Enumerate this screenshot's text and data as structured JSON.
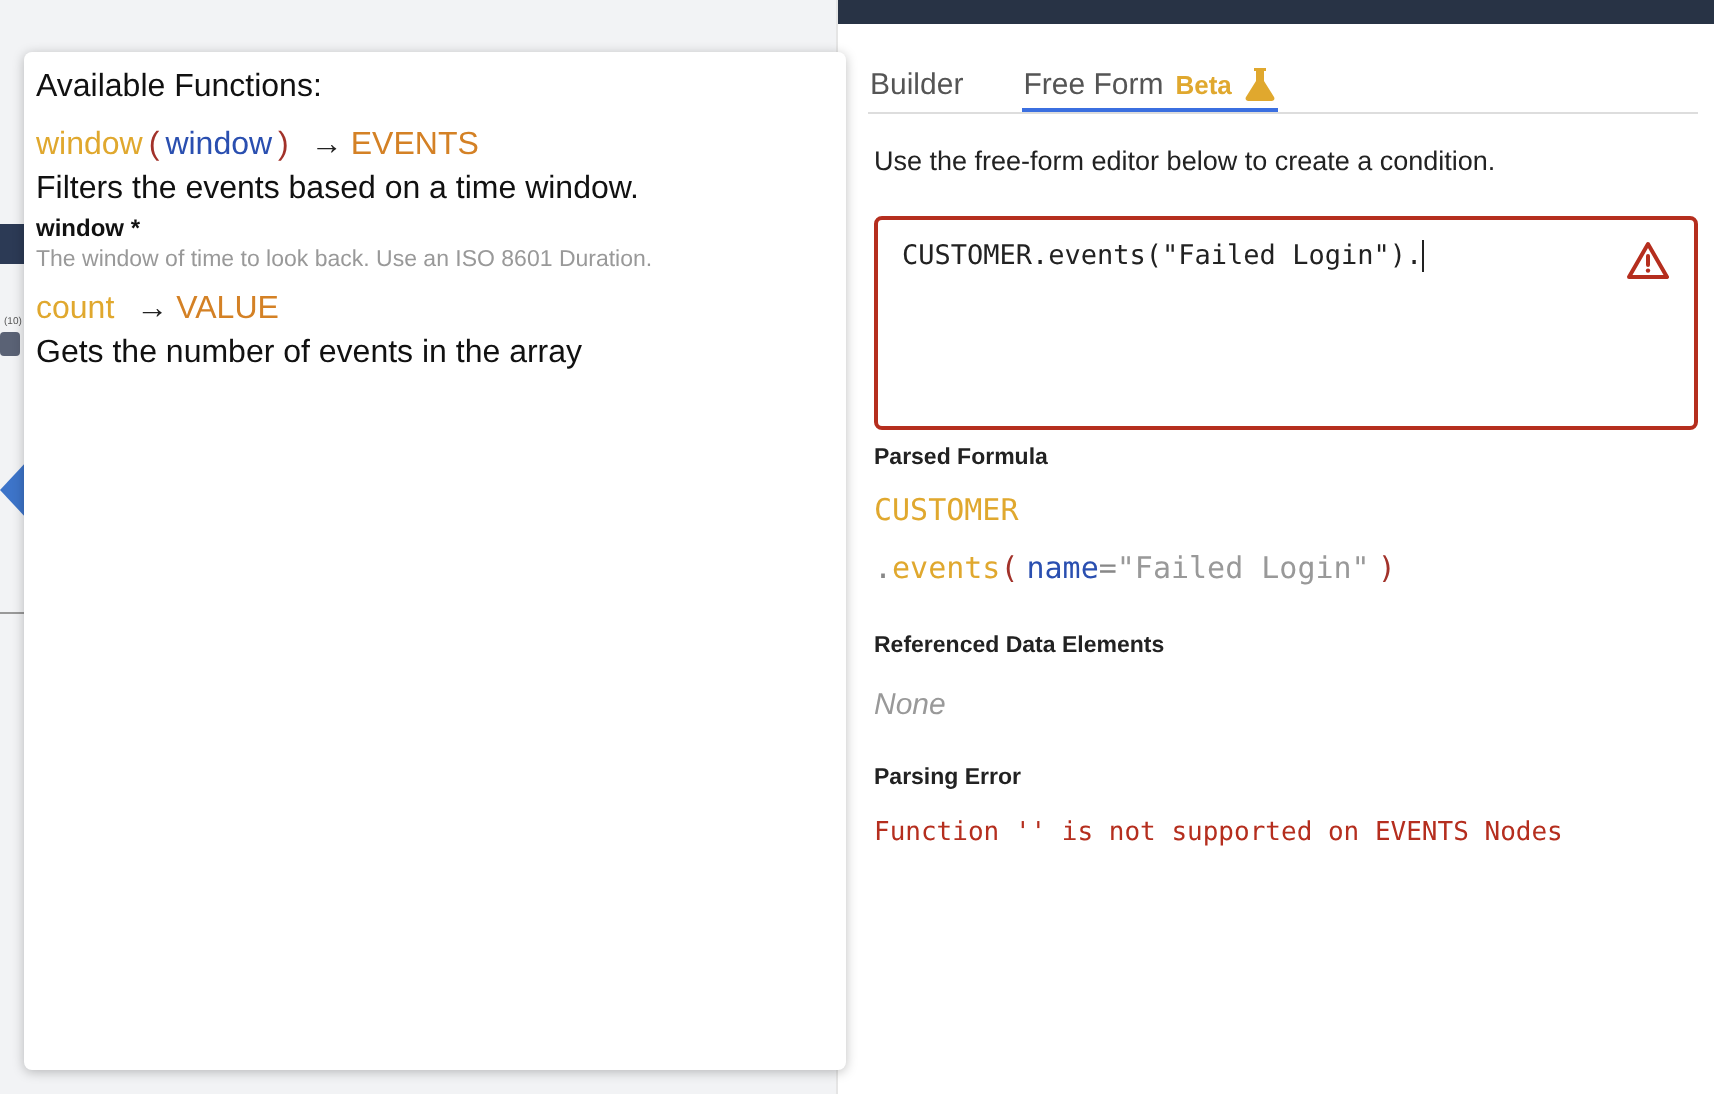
{
  "background": {
    "count_label": "(10)"
  },
  "functions_popup": {
    "title": "Available Functions:",
    "functions": [
      {
        "signature": [
          {
            "kind": "fn",
            "text": "window"
          },
          {
            "kind": "paren",
            "text": "("
          },
          {
            "kind": "param",
            "text": "window"
          },
          {
            "kind": "paren",
            "text": ")"
          },
          {
            "kind": "arrow",
            "text": "→"
          },
          {
            "kind": "type",
            "text": "EVENTS"
          }
        ],
        "description": "Filters the events based on a time window.",
        "params": [
          {
            "name": "window *",
            "description": "The window of time to look back. Use an ISO 8601 Duration."
          }
        ]
      },
      {
        "signature": [
          {
            "kind": "fn",
            "text": "count"
          },
          {
            "kind": "arrow",
            "text": "→"
          },
          {
            "kind": "type",
            "text": "VALUE"
          }
        ],
        "description": "Gets the number of events in the array"
      }
    ]
  },
  "tabs": [
    {
      "label": "Builder",
      "selected": false
    },
    {
      "label": "Free Form",
      "badge": "Beta",
      "selected": true
    }
  ],
  "instructions": "Use the free-form editor below to create a condition.",
  "editor": {
    "value": "CUSTOMER.events(\"Failed Login\").",
    "has_error": true
  },
  "parsed_formula": {
    "heading": "Parsed Formula",
    "lines": [
      [
        {
          "kind": "root",
          "text": "CUSTOMER"
        }
      ],
      [
        {
          "kind": "dot",
          "text": "."
        },
        {
          "kind": "method",
          "text": "events"
        },
        {
          "kind": "paren",
          "text": "("
        },
        {
          "kind": "arg",
          "text": "name"
        },
        {
          "kind": "dot",
          "text": "="
        },
        {
          "kind": "string",
          "text": "\"Failed Login\""
        },
        {
          "kind": "paren",
          "text": ")"
        }
      ]
    ]
  },
  "referenced": {
    "heading": "Referenced Data Elements",
    "empty_text": "None"
  },
  "parsing_error": {
    "heading": "Parsing Error",
    "message": "Function '' is not supported on EVENTS Nodes"
  }
}
